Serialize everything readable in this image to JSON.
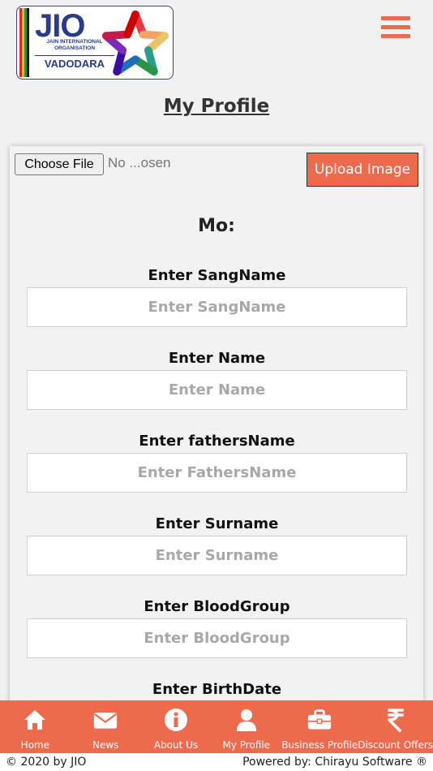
{
  "header": {
    "logo": {
      "title": "JIO",
      "subtitle_line1": "JAIN INTERNATIONAL",
      "subtitle_line2": "ORGANISATION",
      "city": "VADODARA",
      "flag_colors": [
        "#d62828",
        "#f2c200",
        "#2b9348",
        "#111111"
      ]
    },
    "menu_icon": "hamburger-icon"
  },
  "page": {
    "title": "My Profile"
  },
  "upload": {
    "choose_label": "Choose File",
    "file_status": "No ...osen",
    "upload_label": "Upload Image"
  },
  "mobile_label": "Mo:",
  "form": {
    "fields": [
      {
        "label": "Enter SangName",
        "placeholder": "Enter SangName",
        "value": ""
      },
      {
        "label": "Enter Name",
        "placeholder": "Enter Name",
        "value": ""
      },
      {
        "label": "Enter fathersName",
        "placeholder": "Enter FathersName",
        "value": ""
      },
      {
        "label": "Enter Surname",
        "placeholder": "Enter Surname",
        "value": ""
      },
      {
        "label": "Enter BloodGroup",
        "placeholder": "Enter BloodGroup",
        "value": ""
      },
      {
        "label": "Enter BirthDate",
        "placeholder": "",
        "value": ""
      }
    ]
  },
  "nav": {
    "items": [
      {
        "label": "Home",
        "icon": "home-icon"
      },
      {
        "label": "News",
        "icon": "envelope-icon"
      },
      {
        "label": "About Us",
        "icon": "info-icon"
      },
      {
        "label": "My Profile",
        "icon": "user-icon"
      },
      {
        "label": "Business Profile",
        "icon": "briefcase-icon"
      },
      {
        "label": "Discount Offers",
        "icon": "rupee-icon"
      }
    ]
  },
  "footer": {
    "copyright": "© 2020 by JIO",
    "powered_by": "Powered by: Chirayu Software ®"
  },
  "colors": {
    "accent": "#ee6a4d",
    "background": "#f1f1f1",
    "logo_blue": "#2a3a8c"
  }
}
